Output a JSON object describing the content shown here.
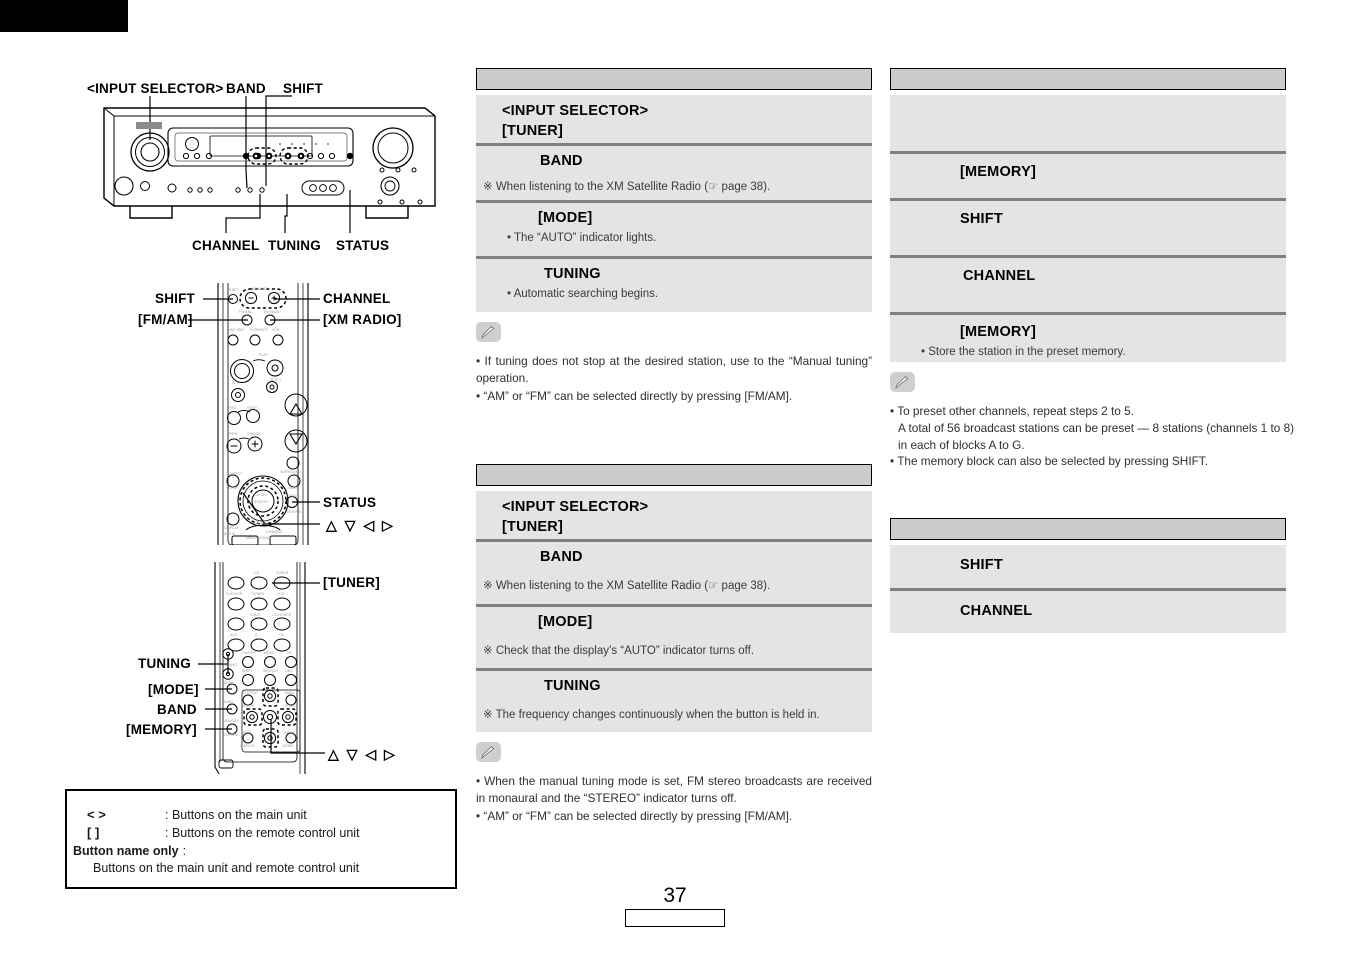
{
  "page": {
    "number": "37"
  },
  "legend": {
    "rows": [
      {
        "key": "<    >",
        "text": ": Buttons on the main unit"
      },
      {
        "key": "[    ]",
        "text": ": Buttons on the remote control unit"
      }
    ],
    "bold_key": "Button name only",
    "bold_sep": ":",
    "bold_text": "Buttons on the main unit and remote control unit"
  },
  "diagrams": {
    "main_unit": {
      "name": "main-unit-front-panel",
      "labels_top": [
        "<INPUT SELECTOR>",
        "BAND",
        "SHIFT"
      ],
      "labels_bottom": [
        "CHANNEL",
        "TUNING",
        "STATUS"
      ]
    },
    "remote_1": {
      "name": "remote-control-upper",
      "labels_left": [
        "SHIFT",
        "[FM/AM]"
      ],
      "labels_right": [
        "CHANNEL",
        "[XM RADIO]"
      ],
      "label_status": "STATUS",
      "label_cursor": "△ ▽ ◁ ▷"
    },
    "remote_2": {
      "name": "remote-control-lower",
      "label_tuner": "[TUNER]",
      "labels_left": [
        "TUNING",
        "[MODE]",
        "BAND",
        "[MEMORY]"
      ],
      "label_cursor": "△ ▽ ◁ ▷"
    }
  },
  "sections": [
    {
      "id": "auto-tuning",
      "header": "",
      "steps": [
        {
          "title": "<INPUT SELECTOR>\n[TUNER]",
          "note": ""
        },
        {
          "title": "BAND",
          "note": "※ When listening to the XM Satellite Radio (☞ page 38)."
        },
        {
          "title": "[MODE]",
          "note": "• The “AUTO” indicator lights."
        },
        {
          "title": "TUNING",
          "note": "• Automatic searching begins."
        }
      ],
      "notes": [
        "• If tuning does not stop at the desired station, use to the “Manual tuning” operation.",
        "• “AM” or “FM” can be selected directly by pressing [FM/AM]."
      ]
    },
    {
      "id": "manual-tuning",
      "header": "",
      "steps": [
        {
          "title": "<INPUT SELECTOR>\n[TUNER]",
          "note": ""
        },
        {
          "title": "BAND",
          "note": "※ When listening to the XM Satellite Radio (☞ page 38)."
        },
        {
          "title": "[MODE]",
          "note": "※ Check that the display’s “AUTO” indicator turns off."
        },
        {
          "title": "TUNING",
          "note": "※ The frequency changes continuously when the button is held in."
        }
      ],
      "notes": [
        "• When the manual tuning mode is set, FM stereo broadcasts are received in monaural and the “STEREO” indicator turns off.",
        "• “AM” or “FM” can be selected directly by pressing [FM/AM]."
      ]
    },
    {
      "id": "preset-memory",
      "header": "",
      "steps": [
        {
          "title": "",
          "note": ""
        },
        {
          "title": "[MEMORY]",
          "note": ""
        },
        {
          "title": "SHIFT",
          "note": ""
        },
        {
          "title": "CHANNEL",
          "note": ""
        },
        {
          "title": "[MEMORY]",
          "note": "• Store the station in the preset memory."
        }
      ],
      "notes": [
        "• To preset other channels, repeat steps 2 to 5.",
        "A total of 56 broadcast stations can be preset — 8 stations (channels 1 to 8) in each of blocks A to G.",
        "• The memory block can also be selected by pressing SHIFT."
      ]
    },
    {
      "id": "preset-recall",
      "header": "",
      "steps": [
        {
          "title": "SHIFT",
          "note": ""
        },
        {
          "title": "CHANNEL",
          "note": ""
        }
      ],
      "notes": []
    }
  ],
  "colors": {
    "header_bar": "#cccccc",
    "panel_bg": "#e4e4e4",
    "divider": "#808080",
    "text": "#000000",
    "note_text": "#2f2f2f"
  }
}
